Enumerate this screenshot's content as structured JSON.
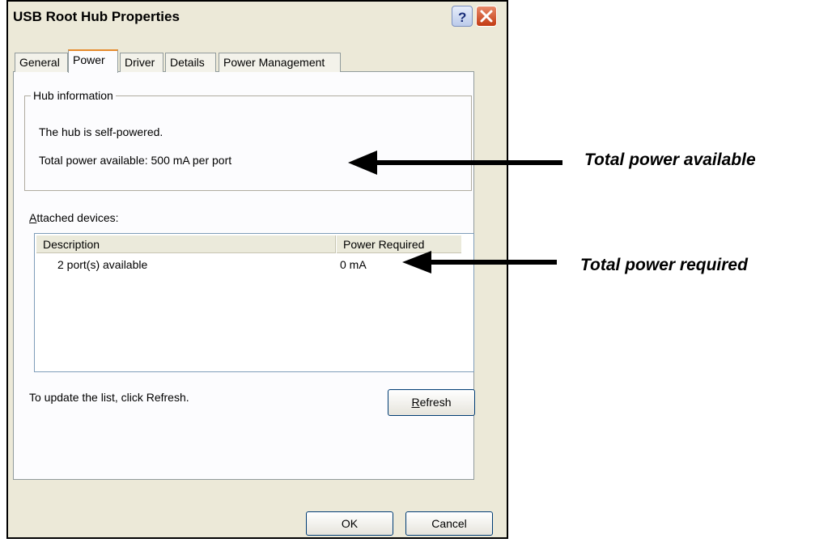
{
  "window": {
    "title": "USB Root Hub Properties",
    "help_icon": "question-mark-icon",
    "close_icon": "close-icon"
  },
  "tabs": [
    {
      "label": "General",
      "active": false
    },
    {
      "label": "Power",
      "active": true
    },
    {
      "label": "Driver",
      "active": false
    },
    {
      "label": "Details",
      "active": false
    },
    {
      "label": "Power Management",
      "active": false
    }
  ],
  "hub_info": {
    "legend": "Hub information",
    "self_powered": "The hub is self-powered.",
    "total_power": "Total power available:  500 mA per port"
  },
  "attached": {
    "label_prefix": "A",
    "label_rest": "ttached devices:",
    "columns": [
      "Description",
      "Power Required"
    ],
    "rows": [
      {
        "description": "2 port(s) available",
        "power": "0 mA"
      }
    ]
  },
  "hint": "To update the list, click Refresh.",
  "buttons": {
    "refresh_prefix": "R",
    "refresh_rest": "efresh",
    "ok": "OK",
    "cancel": "Cancel"
  },
  "annotations": {
    "total_available": "Total power available",
    "total_required": "Total power required"
  },
  "colors": {
    "dialog_bg": "#ece9d8",
    "active_tab_accent": "#e68b2c",
    "close_button": "#c23a12"
  }
}
